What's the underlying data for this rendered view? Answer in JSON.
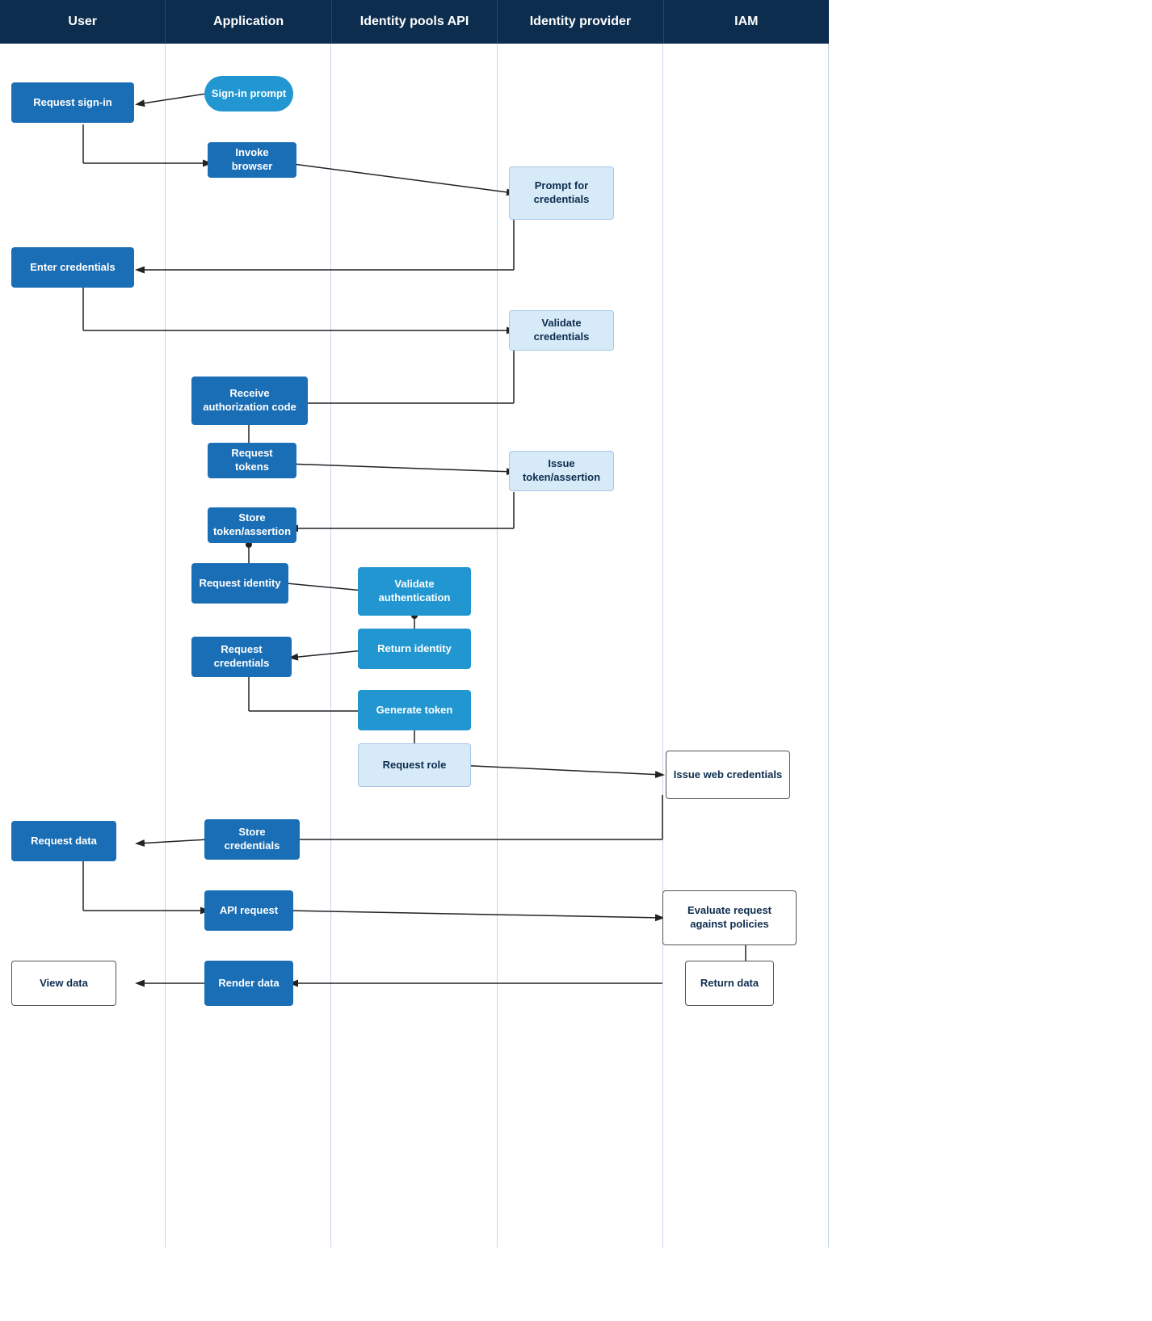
{
  "header": {
    "columns": [
      "User",
      "Application",
      "Identity pools API",
      "Identity provider",
      "IAM"
    ]
  },
  "boxes": {
    "request_signin": {
      "label": "Request sign-in",
      "style": "dark-blue"
    },
    "signin_prompt": {
      "label": "Sign-in prompt",
      "style": "oval"
    },
    "invoke_browser": {
      "label": "Invoke browser",
      "style": "dark-blue"
    },
    "prompt_credentials": {
      "label": "Prompt for credentials",
      "style": "light-blue"
    },
    "enter_credentials": {
      "label": "Enter credentials",
      "style": "dark-blue"
    },
    "validate_credentials": {
      "label": "Validate credentials",
      "style": "light-blue"
    },
    "receive_auth_code": {
      "label": "Receive authorization code",
      "style": "dark-blue"
    },
    "request_tokens": {
      "label": "Request tokens",
      "style": "dark-blue"
    },
    "issue_token": {
      "label": "Issue token/assertion",
      "style": "light-blue"
    },
    "store_token": {
      "label": "Store token/assertion",
      "style": "dark-blue"
    },
    "request_identity": {
      "label": "Request identity",
      "style": "dark-blue"
    },
    "validate_auth": {
      "label": "Validate authentication",
      "style": "medium-blue"
    },
    "return_identity": {
      "label": "Return identity",
      "style": "medium-blue"
    },
    "request_credentials": {
      "label": "Request credentials",
      "style": "dark-blue"
    },
    "generate_token": {
      "label": "Generate token",
      "style": "medium-blue"
    },
    "request_role": {
      "label": "Request role",
      "style": "light-blue"
    },
    "issue_web_credentials": {
      "label": "Issue web credentials",
      "style": "white"
    },
    "store_credentials": {
      "label": "Store credentials",
      "style": "dark-blue"
    },
    "request_data": {
      "label": "Request data",
      "style": "dark-blue"
    },
    "api_request": {
      "label": "API request",
      "style": "dark-blue"
    },
    "evaluate_request": {
      "label": "Evaluate request against policies",
      "style": "white"
    },
    "view_data": {
      "label": "View data",
      "style": "white"
    },
    "render_data": {
      "label": "Render data",
      "style": "dark-blue"
    },
    "return_data": {
      "label": "Return data",
      "style": "white"
    }
  }
}
